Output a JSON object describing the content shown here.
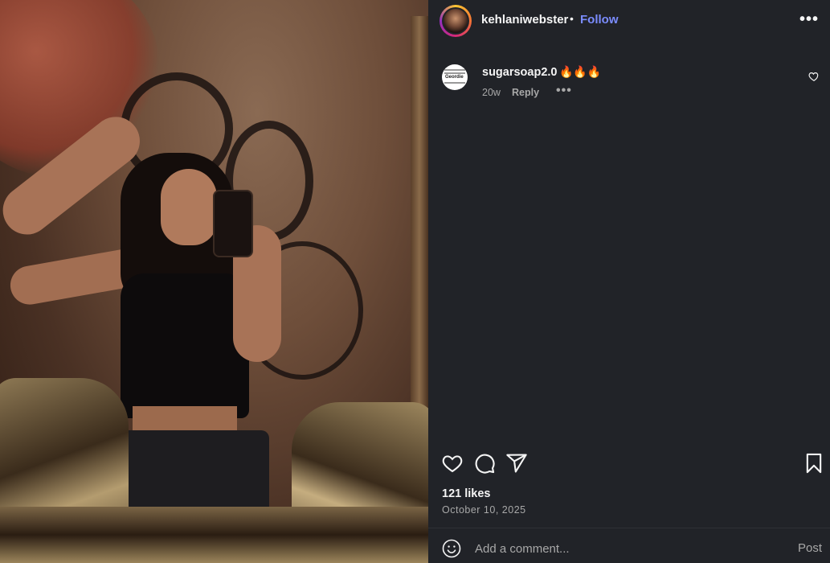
{
  "post": {
    "username": "kehlaniwebster",
    "separator": "•",
    "follow_label": "Follow",
    "more_label": "•••"
  },
  "comments": [
    {
      "username": "sugarsoap2.0",
      "text": "🔥🔥🔥",
      "age": "20w",
      "reply_label": "Reply",
      "more_label": "•••",
      "avatar_text": "Geordie"
    }
  ],
  "actions": {
    "icons": [
      "heart-icon",
      "comment-icon",
      "share-icon",
      "bookmark-icon"
    ]
  },
  "likes": "121 likes",
  "date": "October 10, 2025",
  "comment_box": {
    "placeholder": "Add a comment...",
    "post_label": "Post"
  },
  "colors": {
    "panel_bg": "#212328",
    "follow_blue": "#7b8cff",
    "muted_text": "#a8a8a8"
  }
}
